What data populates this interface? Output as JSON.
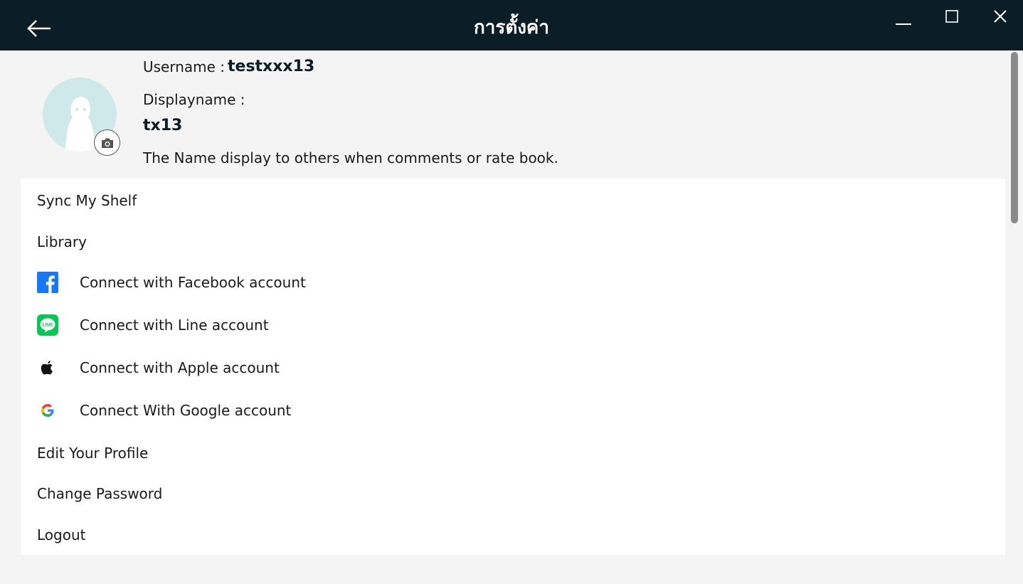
{
  "window": {
    "title": "การตั้งค่า"
  },
  "profile": {
    "username_label": "Username :",
    "username": "testxxx13",
    "displayname_label": "Displayname :",
    "displayname": "tx13",
    "display_hint": "The Name display to others when comments or rate book."
  },
  "menu": {
    "sync": "Sync My Shelf",
    "library": "Library",
    "facebook": "Connect with Facebook account",
    "line": "Connect with Line account",
    "line_icon_text": "LINE",
    "apple": "Connect with Apple account",
    "google": "Connect With Google account",
    "edit_profile": "Edit Your Profile",
    "change_password": "Change Password",
    "logout": "Logout"
  },
  "colors": {
    "titlebar": "#0b1d27",
    "facebook": "#1877f2",
    "line": "#06c755",
    "avatar_bg": "#cfe9ea"
  },
  "icons": {
    "back": "arrow-left-icon",
    "minimize": "minimize-icon",
    "maximize": "maximize-icon",
    "close": "close-icon",
    "camera": "camera-icon",
    "facebook": "facebook-icon",
    "line": "line-icon",
    "apple": "apple-icon",
    "google": "google-icon"
  }
}
